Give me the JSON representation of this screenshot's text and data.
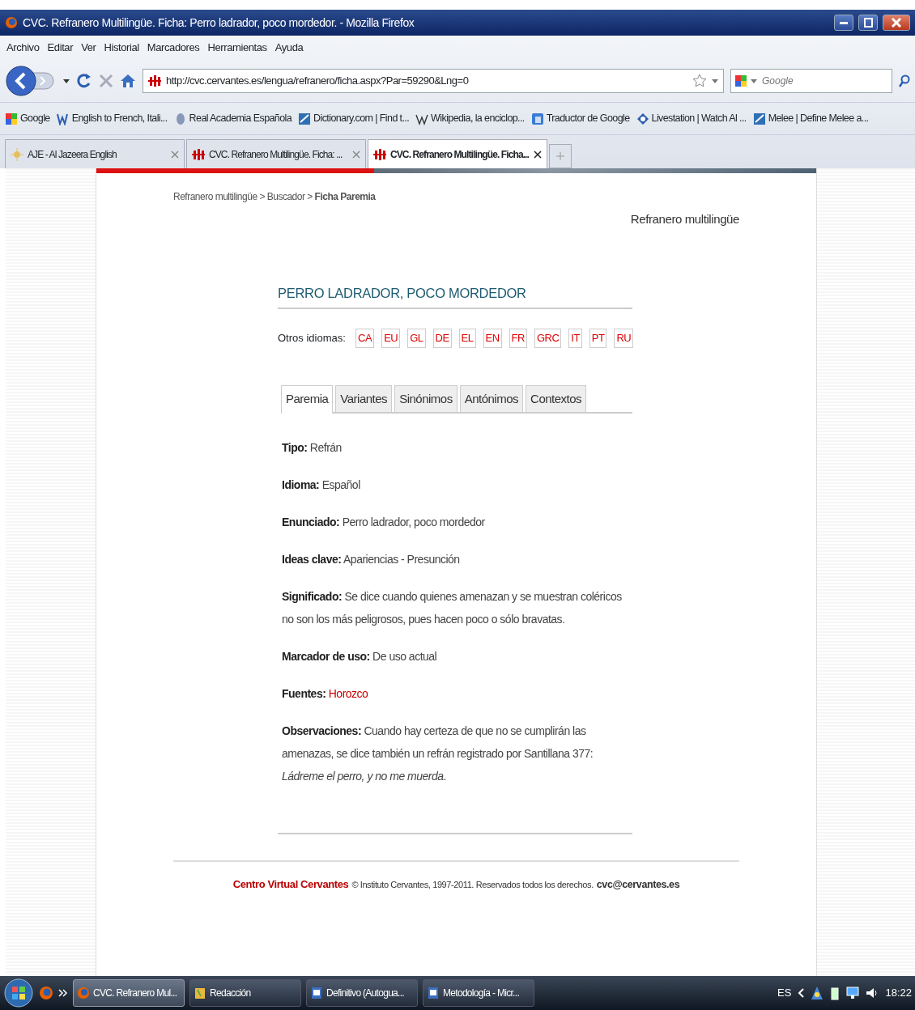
{
  "window": {
    "title": "CVC. Refranero Multilingüe. Ficha: Perro ladrador, poco mordedor. - Mozilla Firefox"
  },
  "menu": [
    "Archivo",
    "Editar",
    "Ver",
    "Historial",
    "Marcadores",
    "Herramientas",
    "Ayuda"
  ],
  "toolbar": {
    "url": "http://cvc.cervantes.es/lengua/refranero/ficha.aspx?Par=59290&Lng=0",
    "search_placeholder": "Google"
  },
  "bookmarks": [
    "Google",
    "English to French, Itali...",
    "Real Academia Española",
    "Dictionary.com | Find t...",
    "Wikipedia, la enciclop...",
    "Traductor de Google",
    "Livestation | Watch Al ...",
    "Melee | Define Melee a..."
  ],
  "browser_tabs": [
    {
      "label": "AJE - Al Jazeera English",
      "selected": false
    },
    {
      "label": "CVC. Refranero Multilingüe. Ficha: ...",
      "selected": false
    },
    {
      "label": "CVC. Refranero Multilingüe. Ficha...",
      "selected": true
    }
  ],
  "page": {
    "breadcrumb": "Refranero multilingüe > Buscador > **Ficha Paremia**",
    "section_title": "Refranero multilingüe",
    "heading": "PERRO LADRADOR, POCO MORDEDOR",
    "other_languages_label": "Otros idiomas:",
    "languages": [
      "CA",
      "EU",
      "GL",
      "DE",
      "EL",
      "EN",
      "FR",
      "GRC",
      "IT",
      "PT",
      "RU"
    ],
    "tabs": [
      {
        "label": "Paremia",
        "selected": true
      },
      {
        "label": "Variantes",
        "selected": false
      },
      {
        "label": "Sinónimos",
        "selected": false
      },
      {
        "label": "Antónimos",
        "selected": false
      },
      {
        "label": "Contextos",
        "selected": false
      }
    ],
    "fields": [
      {
        "label": "Tipo:",
        "value": "Refrán",
        "kind": "text"
      },
      {
        "label": "Idioma:",
        "value": "Español",
        "kind": "text"
      },
      {
        "label": "Enunciado:",
        "value": "Perro ladrador, poco mordedor",
        "kind": "text"
      },
      {
        "label": "Ideas clave:",
        "value": "Apariencias - Presunción",
        "kind": "text"
      },
      {
        "label": "Significado:",
        "value": "Se dice cuando quienes amenazan y se muestran coléricos no son los más peligrosos, pues hacen poco o sólo bravatas.",
        "kind": "text"
      },
      {
        "label": "Marcador de uso:",
        "value": "De uso actual",
        "kind": "text"
      },
      {
        "label": "Fuentes:",
        "value": "Horozco",
        "kind": "link"
      },
      {
        "label": "Observaciones:",
        "value": "Cuando hay certeza de que no se cumplirán las amenazas, se dice también un refrán registrado por Santillana 377: *Ládreme el perro, y no me muerda*.",
        "kind": "text"
      }
    ],
    "footer": {
      "brand": "Centro Virtual Cervantes",
      "copyright": "© Instituto Cervantes, 1997-2011. Reservados todos los derechos.",
      "email": "cvc@cervantes.es"
    }
  },
  "taskbar": {
    "items": [
      {
        "label": "CVC. Refranero Mul...",
        "selected": true
      },
      {
        "label": "Redacción",
        "selected": false
      },
      {
        "label": "Definitivo (Autogua...",
        "selected": false
      },
      {
        "label": "Metodología - Micr...",
        "selected": false
      }
    ],
    "language": "ES",
    "clock": "18:22"
  }
}
